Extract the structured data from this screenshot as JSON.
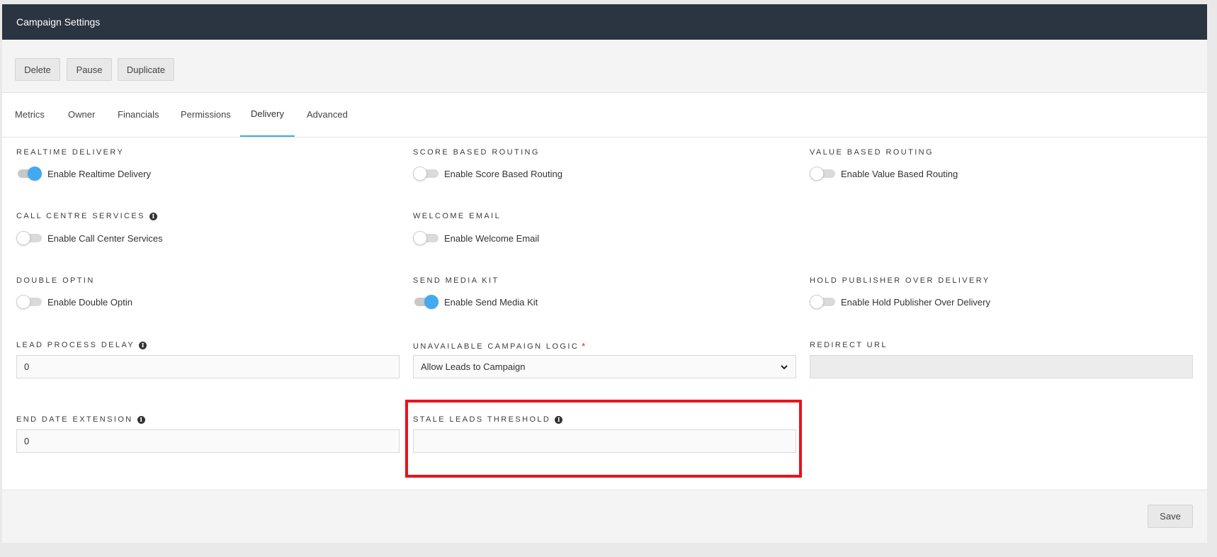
{
  "header": {
    "title": "Campaign Settings"
  },
  "toolbar": {
    "delete_label": "Delete",
    "pause_label": "Pause",
    "duplicate_label": "Duplicate"
  },
  "tabs": [
    {
      "label": "Metrics",
      "active": false
    },
    {
      "label": "Owner",
      "active": false
    },
    {
      "label": "Financials",
      "active": false
    },
    {
      "label": "Permissions",
      "active": false
    },
    {
      "label": "Delivery",
      "active": true
    },
    {
      "label": "Advanced",
      "active": false
    }
  ],
  "sections": {
    "realtime_delivery": {
      "label": "REALTIME DELIVERY",
      "toggle_label": "Enable Realtime Delivery",
      "enabled": true
    },
    "score_based_routing": {
      "label": "SCORE BASED ROUTING",
      "toggle_label": "Enable Score Based Routing",
      "enabled": false
    },
    "value_based_routing": {
      "label": "VALUE BASED ROUTING",
      "toggle_label": "Enable Value Based Routing",
      "enabled": false
    },
    "call_centre_services": {
      "label": "CALL CENTRE SERVICES",
      "toggle_label": "Enable Call Center Services",
      "enabled": false
    },
    "welcome_email": {
      "label": "WELCOME EMAIL",
      "toggle_label": "Enable Welcome Email",
      "enabled": false
    },
    "double_optin": {
      "label": "DOUBLE OPTIN",
      "toggle_label": "Enable Double Optin",
      "enabled": false
    },
    "send_media_kit": {
      "label": "SEND MEDIA KIT",
      "toggle_label": "Enable Send Media Kit",
      "enabled": true
    },
    "hold_publisher": {
      "label": "HOLD PUBLISHER OVER DELIVERY",
      "toggle_label": "Enable Hold Publisher Over Delivery",
      "enabled": false
    },
    "lead_process_delay": {
      "label": "LEAD PROCESS DELAY",
      "value": "0"
    },
    "unavailable_campaign_logic": {
      "label": "UNAVAILABLE CAMPAIGN LOGIC",
      "required_mark": "*",
      "selected": "Allow Leads to Campaign"
    },
    "redirect_url": {
      "label": "REDIRECT URL",
      "value": ""
    },
    "end_date_extension": {
      "label": "END DATE EXTENSION",
      "value": "0"
    },
    "stale_leads_threshold": {
      "label": "STALE LEADS THRESHOLD",
      "value": ""
    }
  },
  "footer": {
    "save_label": "Save"
  },
  "colors": {
    "header_bg": "#2b3441",
    "accent": "#41a8ea",
    "toggle_on": "#42aaf0",
    "highlight": "#e8131b",
    "required": "#d9232d"
  },
  "icons": {
    "info": "info-circle-icon",
    "chevron": "chevron-down-icon"
  }
}
